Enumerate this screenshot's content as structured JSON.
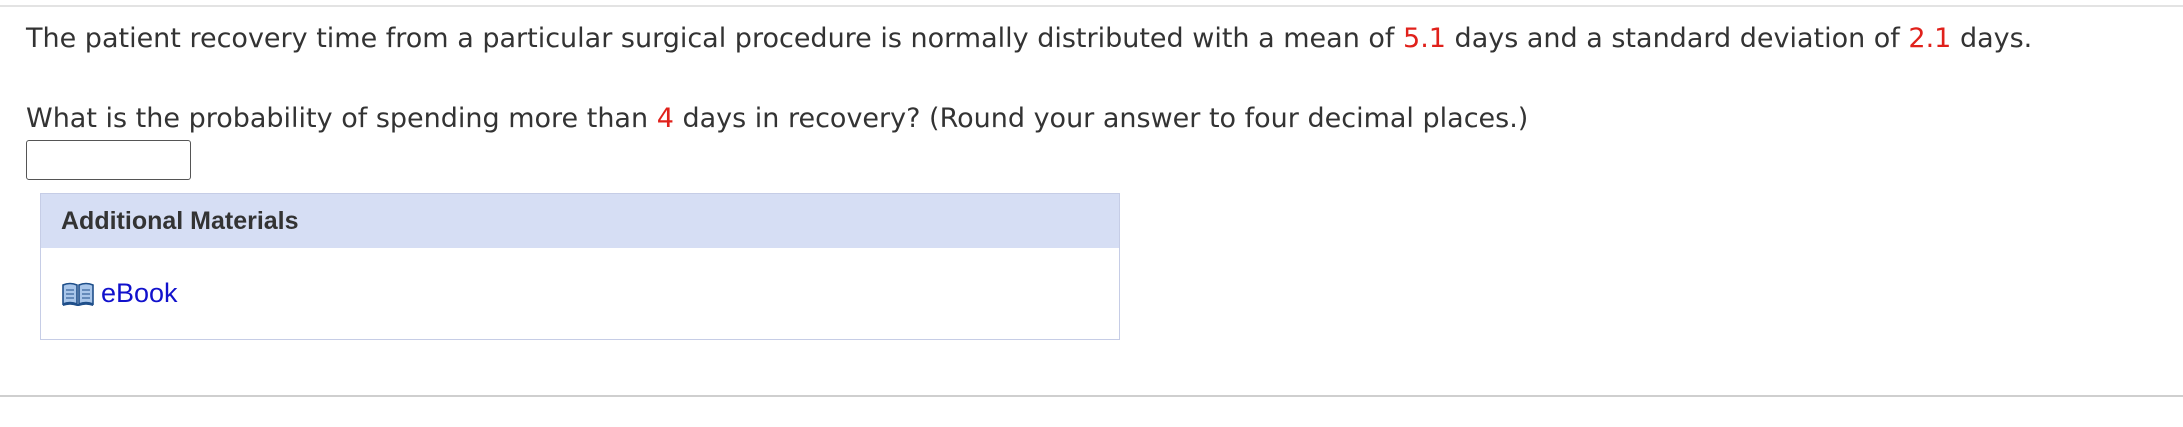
{
  "question": {
    "sentence1": {
      "before_mean": "The patient recovery time from a particular surgical procedure is normally distributed with a mean of ",
      "mean": "5.1",
      "between": " days and a standard deviation of ",
      "sd": "2.1",
      "after_sd": " days."
    },
    "sentence2": {
      "before_value": "What is the probability of spending more than ",
      "value": "4",
      "after_value": " days in recovery? (Round your answer to four decimal places.)"
    }
  },
  "answer": {
    "value": "",
    "placeholder": ""
  },
  "additional_materials": {
    "title": "Additional Materials",
    "items": [
      {
        "label": "eBook",
        "icon": "book-icon"
      }
    ]
  },
  "colors": {
    "highlight": "#e0211b",
    "link": "#1111cc",
    "header_bg": "#d6def4"
  }
}
